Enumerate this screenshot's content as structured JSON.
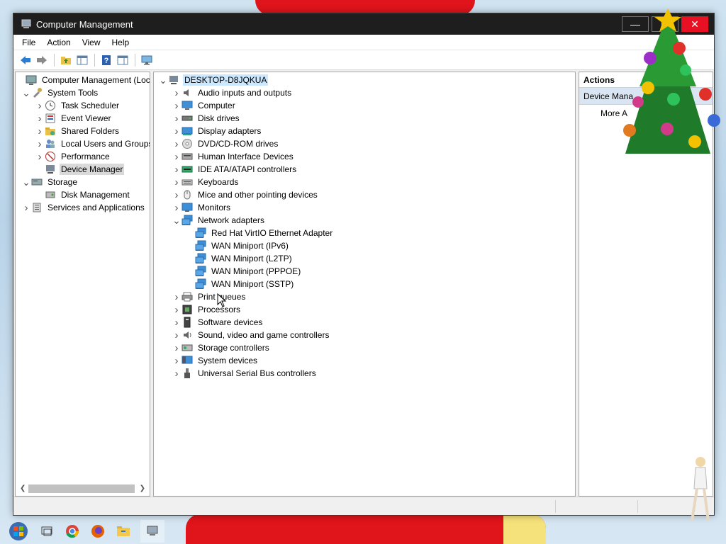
{
  "window": {
    "title": "Computer Management",
    "minimize": "—",
    "maximize": "☐",
    "close": "✕"
  },
  "menu": [
    "File",
    "Action",
    "View",
    "Help"
  ],
  "toolbar_icons": [
    "back-arrow-icon",
    "forward-arrow-icon",
    "up-folder-icon",
    "show-hide-console-tree-icon",
    "help-icon",
    "properties-icon",
    "monitor-icon"
  ],
  "left_tree": [
    {
      "label": "Computer Management (Local",
      "level": 0,
      "chevron": "",
      "icon": "computer-management-icon"
    },
    {
      "label": "System Tools",
      "level": 1,
      "chevron": "down",
      "icon": "tools-icon"
    },
    {
      "label": "Task Scheduler",
      "level": 2,
      "chevron": "right",
      "icon": "clock-icon"
    },
    {
      "label": "Event Viewer",
      "level": 2,
      "chevron": "right",
      "icon": "event-viewer-icon"
    },
    {
      "label": "Shared Folders",
      "level": 2,
      "chevron": "right",
      "icon": "shared-folder-icon"
    },
    {
      "label": "Local Users and Groups",
      "level": 2,
      "chevron": "right",
      "icon": "users-icon"
    },
    {
      "label": "Performance",
      "level": 2,
      "chevron": "right",
      "icon": "performance-icon"
    },
    {
      "label": "Device Manager",
      "level": 2,
      "chevron": "",
      "icon": "device-manager-icon",
      "selected": true
    },
    {
      "label": "Storage",
      "level": 1,
      "chevron": "down",
      "icon": "storage-icon"
    },
    {
      "label": "Disk Management",
      "level": 2,
      "chevron": "",
      "icon": "disk-icon"
    },
    {
      "label": "Services and Applications",
      "level": 1,
      "chevron": "right",
      "icon": "services-icon"
    }
  ],
  "device_tree": {
    "root": "DESKTOP-D8JQKUA",
    "items": [
      {
        "label": "Audio inputs and outputs",
        "icon": "speaker-icon",
        "chevron": "right",
        "level": 1
      },
      {
        "label": "Computer",
        "icon": "computer-icon",
        "chevron": "right",
        "level": 1
      },
      {
        "label": "Disk drives",
        "icon": "disk-drive-icon",
        "chevron": "right",
        "level": 1
      },
      {
        "label": "Display adapters",
        "icon": "display-adapter-icon",
        "chevron": "right",
        "level": 1
      },
      {
        "label": "DVD/CD-ROM drives",
        "icon": "dvd-icon",
        "chevron": "right",
        "level": 1
      },
      {
        "label": "Human Interface Devices",
        "icon": "hid-icon",
        "chevron": "right",
        "level": 1
      },
      {
        "label": "IDE ATA/ATAPI controllers",
        "icon": "ide-icon",
        "chevron": "right",
        "level": 1
      },
      {
        "label": "Keyboards",
        "icon": "keyboard-icon",
        "chevron": "right",
        "level": 1
      },
      {
        "label": "Mice and other pointing devices",
        "icon": "mouse-icon",
        "chevron": "right",
        "level": 1
      },
      {
        "label": "Monitors",
        "icon": "monitor-icon",
        "chevron": "right",
        "level": 1
      },
      {
        "label": "Network adapters",
        "icon": "network-adapter-icon",
        "chevron": "down",
        "level": 1
      },
      {
        "label": "Red Hat VirtIO Ethernet Adapter",
        "icon": "network-adapter-icon",
        "chevron": "",
        "level": 2
      },
      {
        "label": "WAN Miniport (IPv6)",
        "icon": "network-adapter-icon",
        "chevron": "",
        "level": 2
      },
      {
        "label": "WAN Miniport (L2TP)",
        "icon": "network-adapter-icon",
        "chevron": "",
        "level": 2
      },
      {
        "label": "WAN Miniport (PPPOE)",
        "icon": "network-adapter-icon",
        "chevron": "",
        "level": 2
      },
      {
        "label": "WAN Miniport (SSTP)",
        "icon": "network-adapter-icon",
        "chevron": "",
        "level": 2
      },
      {
        "label": "Print queues",
        "icon": "printer-icon",
        "chevron": "right",
        "level": 1
      },
      {
        "label": "Processors",
        "icon": "processor-icon",
        "chevron": "right",
        "level": 1
      },
      {
        "label": "Software devices",
        "icon": "software-device-icon",
        "chevron": "right",
        "level": 1
      },
      {
        "label": "Sound, video and game controllers",
        "icon": "sound-icon",
        "chevron": "right",
        "level": 1
      },
      {
        "label": "Storage controllers",
        "icon": "storage-controller-icon",
        "chevron": "right",
        "level": 1
      },
      {
        "label": "System devices",
        "icon": "system-device-icon",
        "chevron": "right",
        "level": 1
      },
      {
        "label": "Universal Serial Bus controllers",
        "icon": "usb-icon",
        "chevron": "right",
        "level": 1
      }
    ]
  },
  "actions": {
    "header": "Actions",
    "section": "Device Mana",
    "more": "More A"
  },
  "taskbar_icons": [
    "start-orb-icon",
    "task-view-icon",
    "chrome-icon",
    "firefox-icon",
    "file-explorer-icon",
    "computer-management-taskbar-icon"
  ],
  "colors": {
    "titlebar": "#1e1e1e",
    "close": "#e81123",
    "selection": "#cce8ff",
    "actions_sub": "#d9e5f2"
  }
}
